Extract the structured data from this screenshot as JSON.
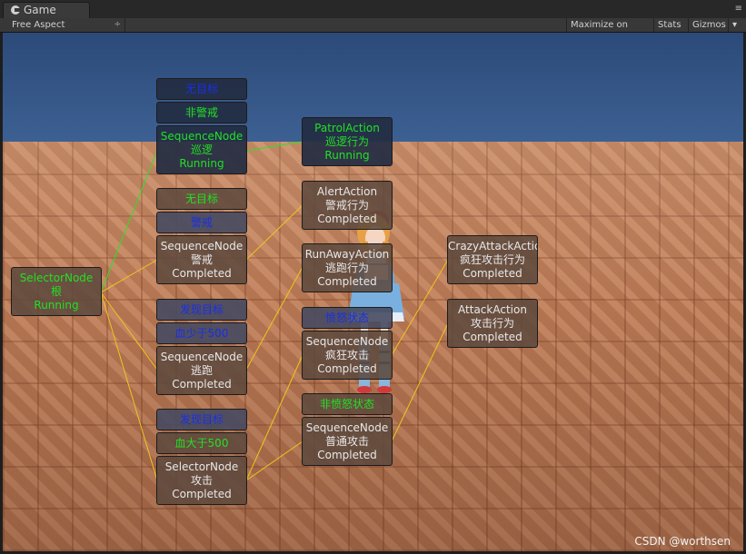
{
  "window": {
    "tab_title": "Game",
    "tab_menu_icon": "≡"
  },
  "toolbar": {
    "aspect_label": "Free Aspect",
    "aspect_arrow": "÷",
    "maximize_on_play": "Maximize on Play",
    "stats": "Stats",
    "gizmos": "Gizmos",
    "gizmos_arrow": "▾"
  },
  "colors": {
    "green": "#22e024",
    "blue": "#1a2fe6",
    "white": "#e8e8e8",
    "link_green": "#2ee02a",
    "link_yellow": "#f2c51a"
  },
  "tree": {
    "root": {
      "lines": [
        "SelectorNode",
        "根",
        "Running"
      ],
      "color": "green"
    },
    "cond_no_target_1": {
      "lines": [
        "无目标"
      ],
      "color": "blue"
    },
    "cond_not_alert": {
      "lines": [
        "非警戒"
      ],
      "color": "green"
    },
    "seq_patrol": {
      "lines": [
        "SequenceNode",
        "巡逻",
        "Running"
      ],
      "color": "green"
    },
    "act_patrol": {
      "lines": [
        "PatrolAction",
        "巡逻行为",
        "Running"
      ],
      "color": "green"
    },
    "cond_no_target_2": {
      "lines": [
        "无目标"
      ],
      "color": "green"
    },
    "cond_alert": {
      "lines": [
        "警戒"
      ],
      "color": "blue"
    },
    "seq_alert": {
      "lines": [
        "SequenceNode",
        "警戒",
        "Completed"
      ],
      "color": "white"
    },
    "act_alert": {
      "lines": [
        "AlertAction",
        "警戒行为",
        "Completed"
      ],
      "color": "white"
    },
    "cond_found_1": {
      "lines": [
        "发现目标"
      ],
      "color": "blue"
    },
    "cond_hp_low": {
      "lines": [
        "血少于500"
      ],
      "color": "blue"
    },
    "seq_flee": {
      "lines": [
        "SequenceNode",
        "逃跑",
        "Completed"
      ],
      "color": "white"
    },
    "act_runaway": {
      "lines": [
        "RunAwayAction",
        "逃跑行为",
        "Completed"
      ],
      "color": "white"
    },
    "cond_found_2": {
      "lines": [
        "发现目标"
      ],
      "color": "blue"
    },
    "cond_hp_high": {
      "lines": [
        "血大于500"
      ],
      "color": "green"
    },
    "sel_attack": {
      "lines": [
        "SelectorNode",
        "攻击",
        "Completed"
      ],
      "color": "white"
    },
    "cond_rage": {
      "lines": [
        "愤怒状态"
      ],
      "color": "blue"
    },
    "seq_crazy": {
      "lines": [
        "SequenceNode",
        "疯狂攻击",
        "Completed"
      ],
      "color": "white"
    },
    "act_crazy": {
      "lines": [
        "CrazyAttackAction",
        "疯狂攻击行为",
        "Completed"
      ],
      "color": "white"
    },
    "cond_not_rage": {
      "lines": [
        "非愤怒状态"
      ],
      "color": "green"
    },
    "seq_normal": {
      "lines": [
        "SequenceNode",
        "普通攻击",
        "Completed"
      ],
      "color": "white"
    },
    "act_attack": {
      "lines": [
        "AttackAction",
        "攻击行为",
        "Completed"
      ],
      "color": "white"
    }
  },
  "watermark": "CSDN @worthsen"
}
